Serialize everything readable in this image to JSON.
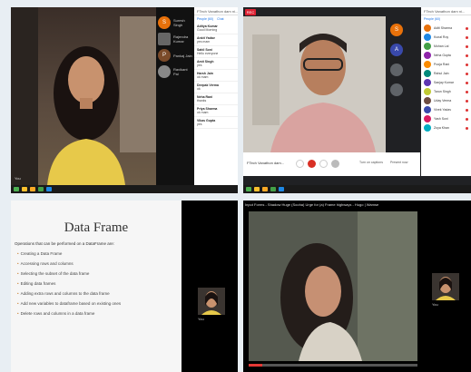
{
  "q1": {
    "rec": "REC",
    "chat_header": "FTech Vanathon dam ni...",
    "tabs": [
      "People (60)",
      "Chat"
    ],
    "chat": [
      {
        "name": "Aditya Kumar",
        "text": "Good Morning"
      },
      {
        "name": "Ankit Yadav",
        "text": "yes mam"
      },
      {
        "name": "Sahil Soni",
        "text": "Hello everyone"
      },
      {
        "name": "Amit Singh",
        "text": "yes"
      },
      {
        "name": "Harsh Jain",
        "text": "ok mam"
      },
      {
        "name": "Deepak Verma",
        "text": "ok"
      },
      {
        "name": "Neha Rani",
        "text": "thanks"
      },
      {
        "name": "Priya Sharma",
        "text": "ok mam"
      },
      {
        "name": "Vikas Gupta",
        "text": "yes"
      }
    ],
    "participants": [
      {
        "initial": "S",
        "name": "Suresh Singh",
        "color": "#e8710a"
      },
      {
        "initial": "",
        "name": "Rajendra Kumar",
        "color": "#666666"
      },
      {
        "initial": "P",
        "name": "Pankaj Jain",
        "color": "#7b4b2a"
      },
      {
        "initial": "",
        "name": "Ravikant Pal",
        "color": "#888888"
      }
    ],
    "self_label": "You"
  },
  "q2": {
    "rec": "REC",
    "meeting_name": "FTech Vanathon dam...",
    "participants_header": "FTech Vanathon dam ni...",
    "people_tab": "People (60)",
    "grid_tiles": [
      {
        "initial": "S",
        "color": "#e8710a"
      },
      {
        "initial": "A",
        "color": "#3949ab"
      },
      {
        "initial": "",
        "color": "#5f6368"
      },
      {
        "initial": "",
        "color": "#5f6368"
      }
    ],
    "people": [
      {
        "name": "Aditi Sharma",
        "color": "#e8710a"
      },
      {
        "name": "Kunal Roy",
        "color": "#1e88e5"
      },
      {
        "name": "Mohan Lal",
        "color": "#43a047"
      },
      {
        "name": "Neha Gupta",
        "color": "#8e24aa"
      },
      {
        "name": "Pooja Rani",
        "color": "#fb8c00"
      },
      {
        "name": "Rahul Jain",
        "color": "#00897b"
      },
      {
        "name": "Sanjay Kumar",
        "color": "#5e35b1"
      },
      {
        "name": "Tarun Singh",
        "color": "#c0ca33"
      },
      {
        "name": "Uday Verma",
        "color": "#6d4c41"
      },
      {
        "name": "Vivek Yadav",
        "color": "#3949ab"
      },
      {
        "name": "Yash Soni",
        "color": "#d81b60"
      },
      {
        "name": "Zoya Khan",
        "color": "#00acc1"
      }
    ],
    "controls": [
      "mic",
      "camera",
      "end-call",
      "present"
    ],
    "bottom_items": [
      "Turn on captions",
      "Present now"
    ]
  },
  "q3": {
    "slide_title": "Data Frame",
    "intro": "Operations that can be performed on a DataFrame are:",
    "bullets": [
      "Creating a Data Frame",
      "Accessing rows and columns",
      "Selecting the subset of the data frame",
      "Editing data frames",
      "Adding extra rows and columns to the data frame",
      "Add new variables to dataframe based on existing ones",
      "Delete rows and columns in a data frame"
    ],
    "self_label": "You"
  },
  "q4": {
    "video_title": "Input Forms - Shadow Huge (Sooha) Urge for (a) Frame highways - Hugo | Wamse",
    "self_label": "You"
  }
}
